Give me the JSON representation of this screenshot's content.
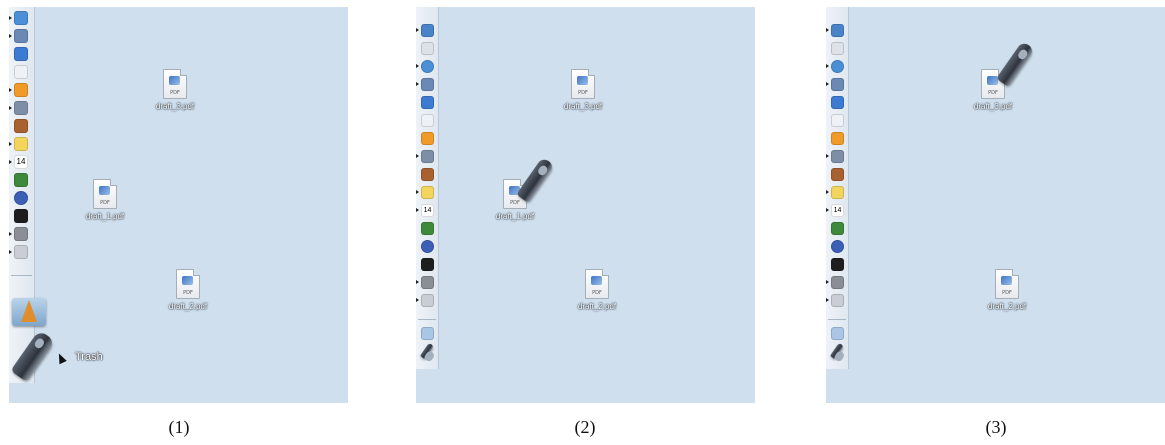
{
  "panels": [
    {
      "caption": "(1)",
      "files": [
        {
          "name": "draft_3.pdf",
          "ext": "PDF"
        },
        {
          "name": "draft_1.pdf",
          "ext": "PDF"
        },
        {
          "name": "draft_2.pdf",
          "ext": "PDF"
        }
      ],
      "dock": {
        "trash_label": "Trash"
      }
    },
    {
      "caption": "(2)",
      "files": [
        {
          "name": "draft_3.pdf",
          "ext": "PDF"
        },
        {
          "name": "draft_1.pdf",
          "ext": "PDF"
        },
        {
          "name": "draft_2.pdf",
          "ext": "PDF"
        }
      ]
    },
    {
      "caption": "(3)",
      "files": [
        {
          "name": "draft_3.pdf",
          "ext": "PDF"
        },
        {
          "name": "draft_2.pdf",
          "ext": "PDF"
        }
      ]
    }
  ],
  "calendar_day": "14",
  "colors": {
    "desktop": "#cfdfee",
    "dock": "#e6edf4"
  },
  "dock_icons": [
    "safari-icon",
    "preview-icon",
    "itunes-icon",
    "wifi-icon",
    "vlc-icon",
    "network-icon",
    "photo-icon",
    "chat-icon",
    "calendar-icon",
    "stocks-icon",
    "globe-icon",
    "terminal-icon",
    "tools-icon",
    "utility-icon"
  ]
}
